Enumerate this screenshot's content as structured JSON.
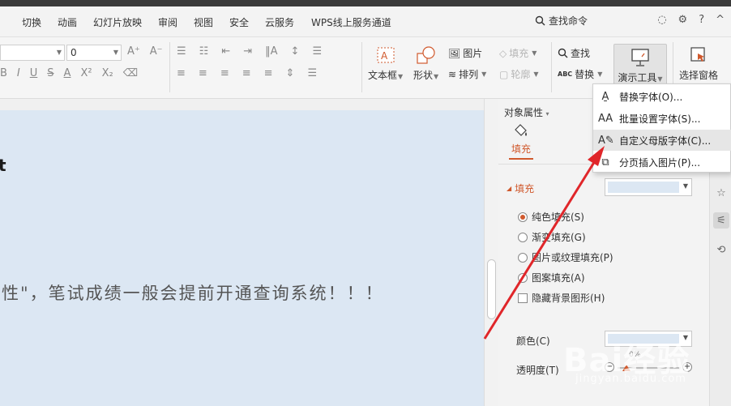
{
  "menubar": {
    "items": [
      "切换",
      "动画",
      "幻灯片放映",
      "审阅",
      "视图",
      "安全",
      "云服务",
      "WPS线上服务通道"
    ],
    "search_label": "查找命令"
  },
  "ribbon": {
    "font_size_value": "0",
    "textbox_label": "文本框",
    "shape_label": "形状",
    "picture_label": "图片",
    "arrange_label": "排列",
    "fill_label": "填充",
    "outline_label": "轮廓",
    "find_label": "查找",
    "replace_label": "替换",
    "demo_tools_label": "演示工具",
    "selection_pane_label": "选择窗格"
  },
  "slide": {
    "heading": "t",
    "body_text": "性\"，笔试成绩一般会提前开通查询系统！！！"
  },
  "pane": {
    "title": "对象属性",
    "tab_fill": "填充",
    "section_fill": "填充",
    "options": [
      {
        "label": "纯色填充(S)",
        "selected": true
      },
      {
        "label": "渐变填充(G)",
        "selected": false
      },
      {
        "label": "图片或纹理填充(P)",
        "selected": false
      },
      {
        "label": "图案填充(A)",
        "selected": false
      }
    ],
    "hide_bg_label": "隐藏背景图形(H)",
    "color_label": "颜色(C)",
    "opacity_label": "透明度(T)",
    "opacity_value": "0%",
    "fill_color": "#dce7f3"
  },
  "dropdown": {
    "items": [
      {
        "label": "替换字体(O)...",
        "icon": "replace-font-icon"
      },
      {
        "label": "批量设置字体(S)...",
        "icon": "batch-font-icon"
      },
      {
        "label": "自定义母版字体(C)...",
        "icon": "master-font-icon"
      },
      {
        "label": "分页插入图片(P)...",
        "icon": "insert-picture-icon"
      }
    ]
  },
  "watermark": {
    "brand": "Bai经验",
    "url": "jingyan.baidu.com"
  },
  "colors": {
    "accent": "#d0592d",
    "arrow": "#e0262a",
    "slide_bg": "#dce7f3"
  }
}
